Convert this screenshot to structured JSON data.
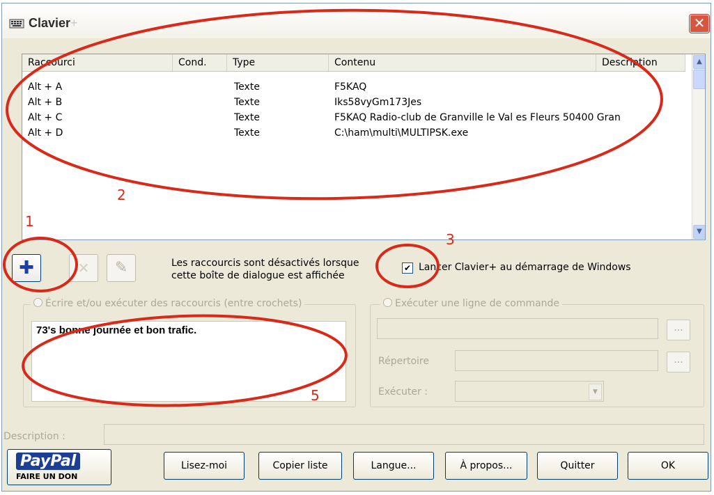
{
  "window": {
    "title": "Clavier",
    "title_suffix": "+",
    "close_glyph": "✕"
  },
  "list": {
    "columns": [
      "Raccourci",
      "Cond.",
      "Type",
      "Contenu",
      "Description"
    ],
    "rows": [
      [
        "Alt + A",
        "",
        "Texte",
        "F5KAQ",
        ""
      ],
      [
        "Alt + B",
        "",
        "Texte",
        "Iks58vyGm173Jes",
        ""
      ],
      [
        "Alt + C",
        "",
        "Texte",
        "F5KAQ  Radio-club de Granville  le Val es Fleurs   50400 Gran",
        ""
      ],
      [
        "Alt + D",
        "",
        "Texte",
        "C:\\ham\\multi\\MULTIPSK.exe",
        ""
      ]
    ]
  },
  "toolbar": {
    "add_glyph": "✚",
    "delete_glyph": "✕",
    "edit_glyph": "✎"
  },
  "note": {
    "line1": "Les raccourcis sont désactivés lorsque",
    "line2": "cette boîte de dialogue est affichée"
  },
  "startup_checkbox": {
    "checked": true,
    "mark": "✔",
    "label": "Lancer Clavier+ au démarrage de Windows"
  },
  "text_group": {
    "legend": "Écrire et/ou exécuter des raccourcis (entre crochets)",
    "value": "73's bonne journée et bon trafic."
  },
  "command_group": {
    "legend": "Exécuter une ligne de commande",
    "browse_label": "...",
    "directory_label": "Répertoire",
    "execute_label": "Exécuter :"
  },
  "description_label": "Description :",
  "buttons": {
    "paypal_logo": "PayPal",
    "paypal_sub": "FAIRE UN DON",
    "readme": "Lisez-moi",
    "copy_list": "Copier liste",
    "language": "Langue...",
    "about": "À propos...",
    "quit": "Quitter",
    "ok": "OK"
  },
  "annotations": {
    "n1": "1",
    "n2": "2",
    "n3": "3",
    "n5": "5",
    "color": "#d72a1a"
  }
}
